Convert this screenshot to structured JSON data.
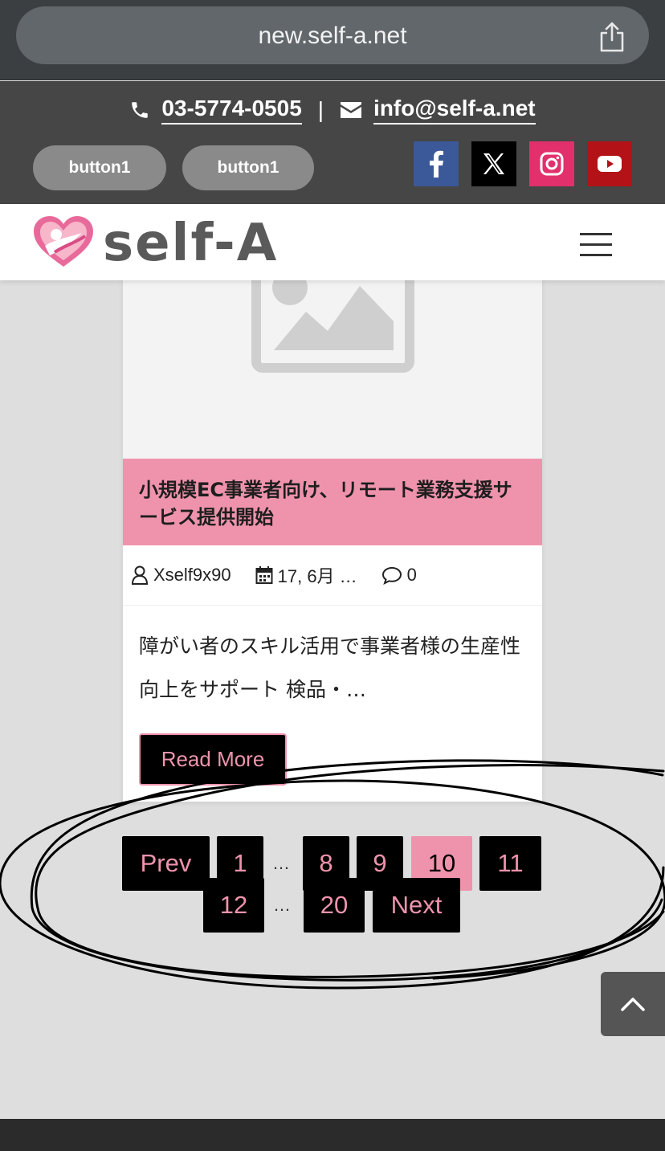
{
  "browser": {
    "url": "new.self-a.net"
  },
  "header": {
    "phone": "03-5774-0505",
    "separator": "|",
    "email": "info@self-a.net",
    "buttons": [
      "button1",
      "button1"
    ],
    "social": [
      "facebook",
      "x",
      "instagram",
      "youtube"
    ],
    "colors": {
      "facebook": "#3b5998",
      "x": "#000000",
      "instagram": "#e1306c",
      "youtube": "#b31217"
    }
  },
  "nav": {
    "logo_text": "self-A"
  },
  "card": {
    "title": "小規模EC事業者向け、リモート業務支援サービス提供開始",
    "author": "Xself9x90",
    "date": "17, 6月 …",
    "comments": "0",
    "excerpt": "障がい者のスキル活用で事業者様の生産性向上をサポート 検品・…",
    "read_more": "Read More"
  },
  "pagination": {
    "prev": "Prev",
    "next": "Next",
    "pages": [
      "1",
      "8",
      "9",
      "10",
      "11",
      "12",
      "20"
    ],
    "current": "10",
    "ellipsis": "…"
  },
  "accent_color": "#ef93ad"
}
